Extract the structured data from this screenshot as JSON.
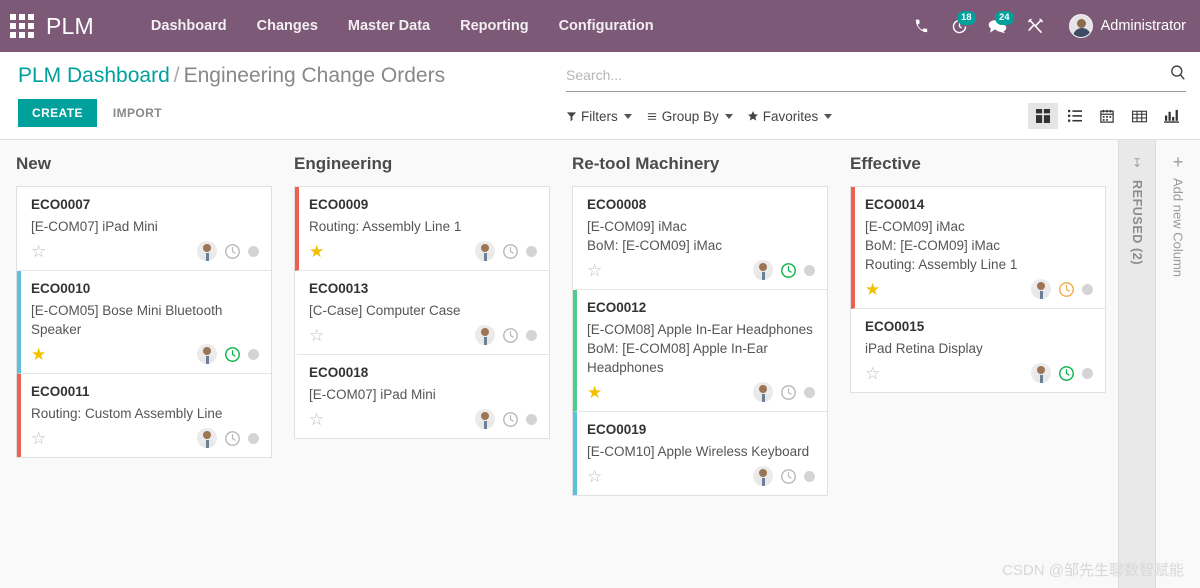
{
  "navbar": {
    "apps_icon": "apps-grid-icon",
    "brand": "PLM",
    "menu": [
      {
        "label": "Dashboard"
      },
      {
        "label": "Changes"
      },
      {
        "label": "Master Data"
      },
      {
        "label": "Reporting"
      },
      {
        "label": "Configuration"
      }
    ],
    "icons": {
      "phone": "phone-icon",
      "activity": "clock-activity-icon",
      "activity_badge": "18",
      "messages": "chat-messages-icon",
      "messages_badge": "24",
      "tools": "wrench-tools-icon"
    },
    "user": {
      "name": "Administrator",
      "avatar": "user-avatar"
    },
    "background_color": "#7C5A77"
  },
  "control_panel": {
    "breadcrumb": {
      "root": "PLM Dashboard",
      "separator": "/",
      "current": "Engineering Change Orders"
    },
    "buttons": {
      "create": "CREATE",
      "import": "IMPORT"
    },
    "search": {
      "placeholder": "Search...",
      "value": ""
    },
    "filters": [
      {
        "label": "Filters",
        "icon": "funnel-icon"
      },
      {
        "label": "Group By",
        "icon": "hamburger-icon"
      },
      {
        "label": "Favorites",
        "icon": "star-icon"
      }
    ],
    "views": [
      {
        "name": "kanban",
        "icon": "kanban-view-icon",
        "active": true
      },
      {
        "name": "list",
        "icon": "list-view-icon",
        "active": false
      },
      {
        "name": "calendar",
        "icon": "calendar-view-icon",
        "active": false
      },
      {
        "name": "pivot",
        "icon": "pivot-view-icon",
        "active": false
      },
      {
        "name": "graph",
        "icon": "graph-view-icon",
        "active": false
      }
    ],
    "accent_color": "#00A09D"
  },
  "kanban": {
    "columns": [
      {
        "title": "New",
        "cards": [
          {
            "title": "ECO0007",
            "lines": [
              "[E-COM07] iPad Mini"
            ],
            "starred": false,
            "accent": "none",
            "clock": "gray",
            "dot": "gray"
          },
          {
            "title": "ECO0010",
            "lines": [
              "[E-COM05] Bose Mini Bluetooth Speaker"
            ],
            "starred": true,
            "accent": "blue",
            "clock": "green",
            "dot": "gray"
          },
          {
            "title": "ECO0011",
            "lines": [
              "Routing: Custom Assembly Line"
            ],
            "starred": false,
            "accent": "red",
            "clock": "gray",
            "dot": "gray"
          }
        ]
      },
      {
        "title": "Engineering",
        "cards": [
          {
            "title": "ECO0009",
            "lines": [
              "Routing: Assembly Line 1"
            ],
            "starred": true,
            "accent": "red",
            "clock": "gray",
            "dot": "gray"
          },
          {
            "title": "ECO0013",
            "lines": [
              "[C-Case] Computer Case"
            ],
            "starred": false,
            "accent": "none",
            "clock": "gray",
            "dot": "gray"
          },
          {
            "title": "ECO0018",
            "lines": [
              "[E-COM07] iPad Mini"
            ],
            "starred": false,
            "accent": "none",
            "clock": "gray",
            "dot": "gray"
          }
        ]
      },
      {
        "title": "Re-tool Machinery",
        "cards": [
          {
            "title": "ECO0008",
            "lines": [
              "[E-COM09] iMac",
              "BoM: [E-COM09] iMac"
            ],
            "starred": false,
            "accent": "none",
            "clock": "green",
            "dot": "gray"
          },
          {
            "title": "ECO0012",
            "lines": [
              "[E-COM08] Apple In-Ear Headphones",
              "BoM: [E-COM08] Apple In-Ear Headphones"
            ],
            "starred": true,
            "accent": "green",
            "clock": "gray",
            "dot": "gray"
          },
          {
            "title": "ECO0019",
            "lines": [
              "[E-COM10] Apple Wireless Keyboard"
            ],
            "starred": false,
            "accent": "blue",
            "clock": "gray",
            "dot": "gray"
          }
        ]
      },
      {
        "title": "Effective",
        "cards": [
          {
            "title": "ECO0014",
            "lines": [
              "[E-COM09] iMac",
              "BoM: [E-COM09] iMac",
              "Routing: Assembly Line 1"
            ],
            "starred": true,
            "accent": "red",
            "clock": "orange",
            "dot": "gray"
          },
          {
            "title": "ECO0015",
            "lines": [
              "iPad Retina Display"
            ],
            "starred": false,
            "accent": "none",
            "clock": "green",
            "dot": "gray"
          }
        ]
      }
    ],
    "folded_column": {
      "label": "REFUSED (2)",
      "arrow_icon": "expand-arrow-icon"
    },
    "add_column": {
      "label": "Add new Column",
      "plus": "+"
    }
  },
  "watermark": "CSDN @邹先生聊数智赋能"
}
